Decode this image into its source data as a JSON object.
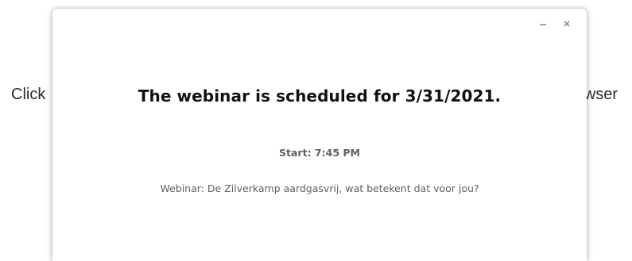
{
  "background": {
    "left_text": "Click",
    "right_text": "wser"
  },
  "dialog": {
    "title": "The webinar is scheduled for 3/31/2021.",
    "start": "Start: 7:45 PM",
    "topic": "Webinar: De Zilverkamp aardgasvrij, wat betekent dat voor jou?",
    "controls": {
      "minimize_icon": "minimize-icon",
      "close_icon": "close-icon"
    }
  },
  "colors": {
    "title": "#111111",
    "secondary_text": "#5d5f6b",
    "control_icon": "#8a8a8a"
  }
}
